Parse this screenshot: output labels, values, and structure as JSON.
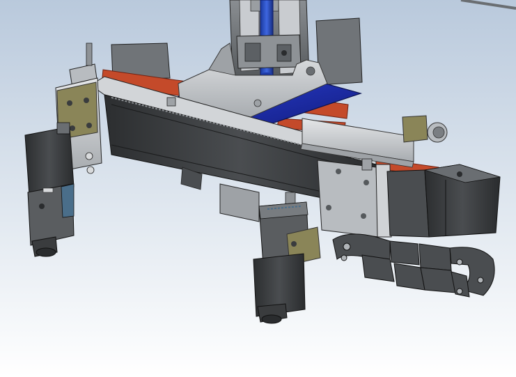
{
  "scene": {
    "colors": {
      "background_top": "#b9c9dc",
      "background_bottom": "#ffffff",
      "gray_dark": "#3a3c3e",
      "gray_mid": "#6e7276",
      "gray_light": "#b5b9bc",
      "blue_plate": "#1f2fb0",
      "orange_rail": "#c44a2a",
      "olive_bracket": "#8a8558"
    }
  }
}
